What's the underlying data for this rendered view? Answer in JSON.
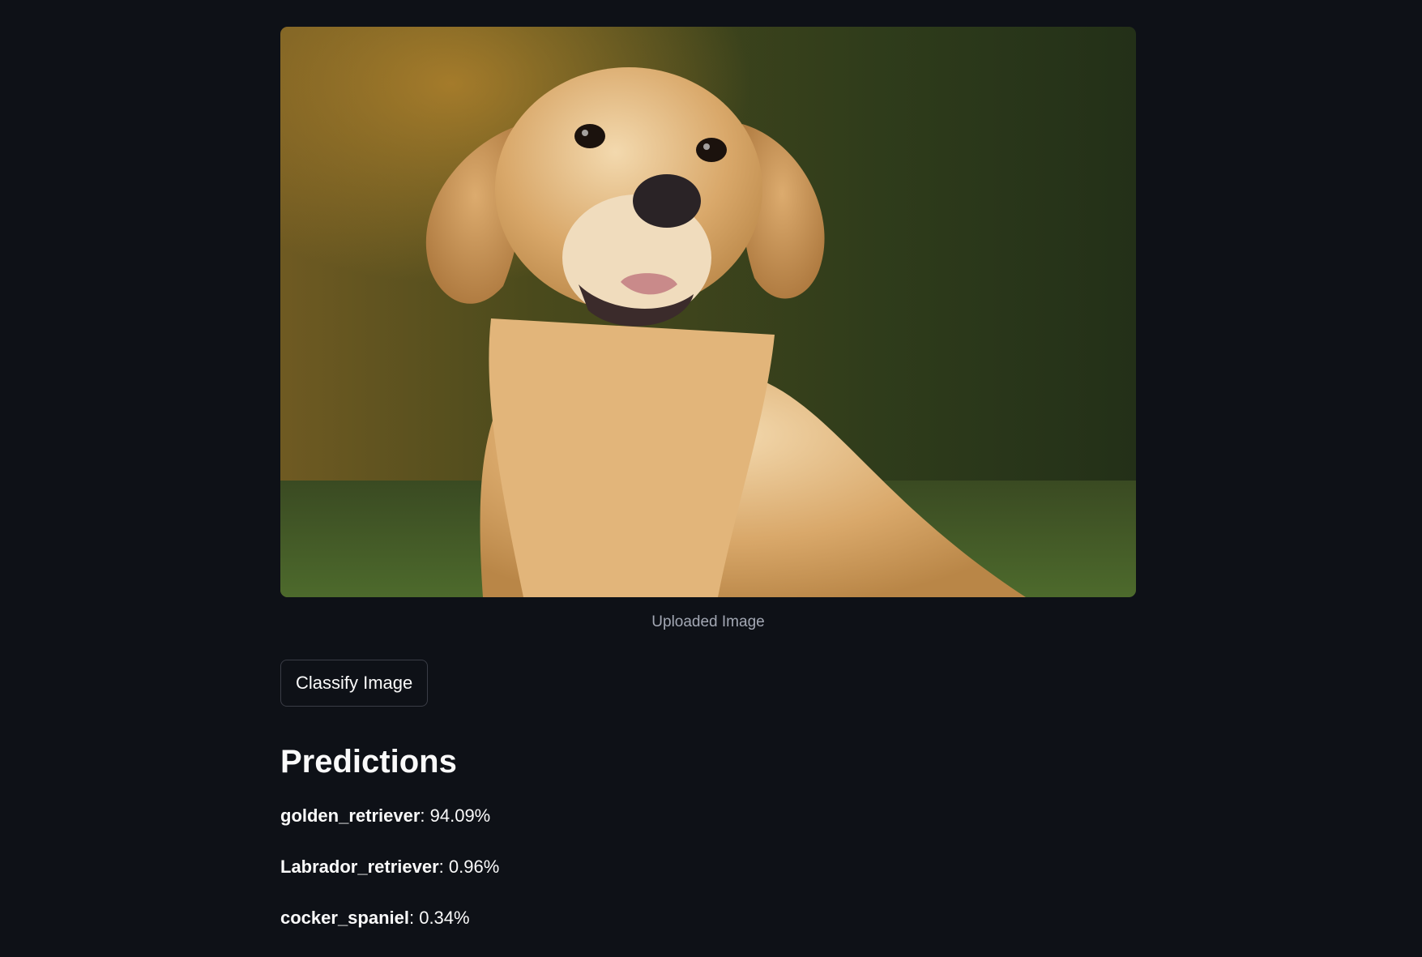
{
  "image": {
    "caption": "Uploaded Image",
    "alt": "golden retriever photo"
  },
  "actions": {
    "classify_label": "Classify Image"
  },
  "predictions": {
    "heading": "Predictions",
    "items": [
      {
        "label": "golden_retriever",
        "value": ": 94.09%"
      },
      {
        "label": "Labrador_retriever",
        "value": ": 0.96%"
      },
      {
        "label": "cocker_spaniel",
        "value": ": 0.34%"
      }
    ]
  },
  "colors": {
    "background": "#0e1117",
    "text": "#fafafa",
    "caption": "#a3a8b4",
    "button_border": "#3a3d46"
  }
}
